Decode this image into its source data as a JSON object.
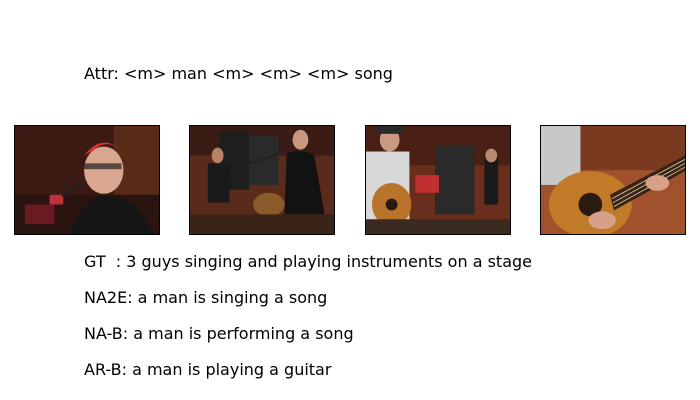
{
  "attr_text": "Attr: <m> man <m> <m> <m> song",
  "frames": [
    {
      "icon": "video-frame-singer-with-microphone"
    },
    {
      "icon": "video-frame-band-in-studio"
    },
    {
      "icon": "video-frame-guitarist-singing"
    },
    {
      "icon": "video-frame-guitar-closeup"
    }
  ],
  "captions": {
    "gt": "GT  : 3 guys singing and playing instruments on a stage",
    "na2e": "NA2E: a man is singing a song",
    "na_b": "NA-B: a man is performing a song",
    "ar_b": "AR-B: a man is playing a guitar"
  }
}
